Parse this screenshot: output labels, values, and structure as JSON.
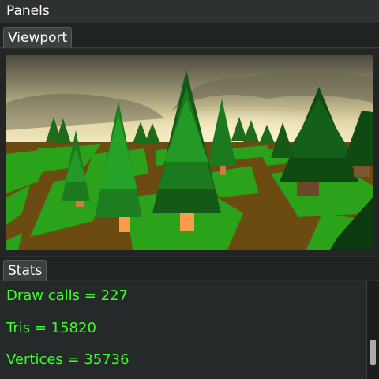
{
  "window": {
    "title": "Panels"
  },
  "viewport": {
    "tab_label": "Viewport"
  },
  "stats": {
    "tab_label": "Stats",
    "lines": [
      "Draw calls = 227",
      "Tris = 15820",
      "Vertices = 35736"
    ]
  },
  "colors": {
    "stat_text": "#3dff2a",
    "panel_bg": "#262929",
    "tab_bar_bg": "#1f2423"
  },
  "scrollbar": {
    "position_fraction": 0.8
  }
}
